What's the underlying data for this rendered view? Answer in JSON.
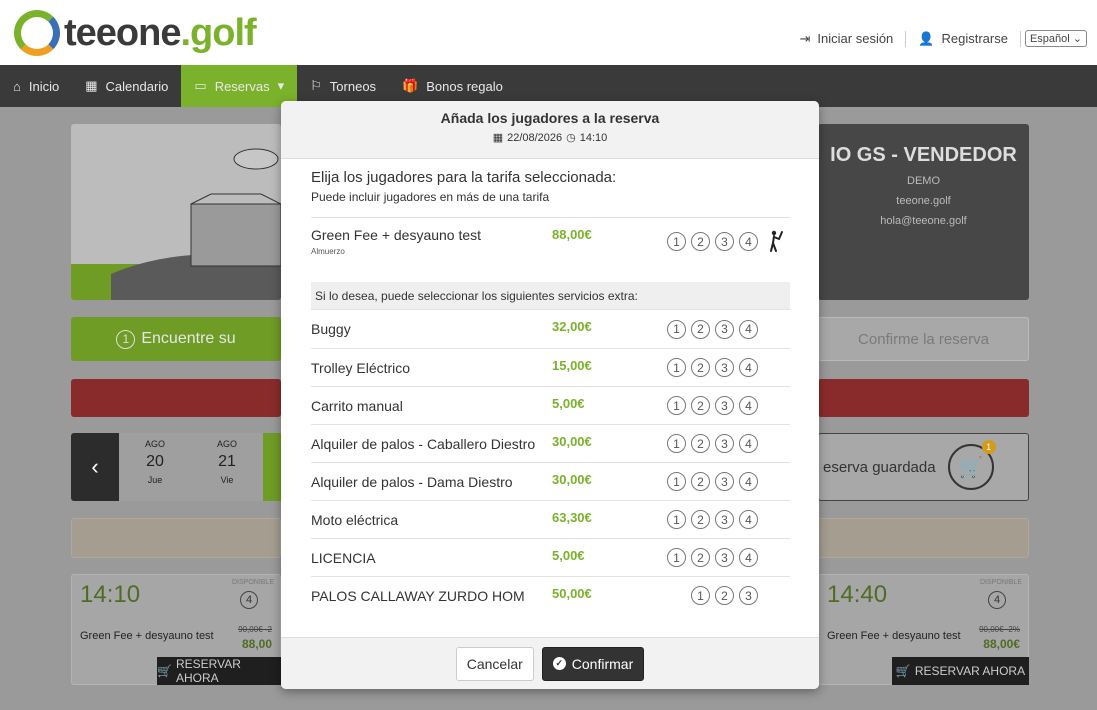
{
  "header": {
    "logo_text_dark": "teeone",
    "logo_text_green": ".golf",
    "login_label": "Iniciar sesión",
    "register_label": "Registrarse",
    "language": "Español"
  },
  "nav": {
    "items": [
      {
        "label": "Inicio",
        "icon": "home-icon"
      },
      {
        "label": "Calendario",
        "icon": "calendar-icon"
      },
      {
        "label": "Reservas",
        "icon": "card-icon",
        "caret": "▾"
      },
      {
        "label": "Torneos",
        "icon": "flag-icon"
      },
      {
        "label": "Bonos regalo",
        "icon": "gift-icon"
      }
    ]
  },
  "background": {
    "club_title": "IO GS - VENDEDOR",
    "club_line1": "DEMO",
    "club_line2": "teeone.golf",
    "club_email": "hola@teeone.golf",
    "step1_num": "1",
    "step1_label": "Encuentre su",
    "step3_label": "Confirme la reserva",
    "dates": [
      {
        "month": "AGO",
        "day": "20",
        "weekday": "Jue"
      },
      {
        "month": "AGO",
        "day": "21",
        "weekday": "Vie"
      }
    ],
    "cart_label": "eserva guardada",
    "cart_count": "1",
    "slot_left": {
      "time": "14:10",
      "available": "DISPONIBLE",
      "players": "4",
      "rate": "Green Fee + desyauno test",
      "old_price": "90,00€ -2",
      "price": "88,00",
      "button": "RESERVAR AHORA"
    },
    "slot_right": {
      "time": "14:40",
      "available": "DISPONIBLE",
      "players": "4",
      "rate": "Green Fee + desyauno test",
      "old_price": "90,00€ -2%",
      "price": "88,00€",
      "button": "RESERVAR AHORA"
    }
  },
  "modal": {
    "title": "Añada los jugadores a la reserva",
    "date": "22/08/2026",
    "time": "14:10",
    "intro_title": "Elija los jugadores para la tarifa seleccionada:",
    "intro_sub": "Puede incluir jugadores en más de una tarifa",
    "rate": {
      "name": "Green Fee + desyauno test",
      "sub": "Almuerzo",
      "price": "88,00€",
      "players": [
        "1",
        "2",
        "3",
        "4"
      ]
    },
    "extras_banner": "Si lo desea, puede seleccionar los siguientes servicios extra:",
    "extras": [
      {
        "name": "Buggy",
        "price": "32,00€",
        "players": [
          "1",
          "2",
          "3",
          "4"
        ]
      },
      {
        "name": "Trolley Eléctrico",
        "price": "15,00€",
        "players": [
          "1",
          "2",
          "3",
          "4"
        ]
      },
      {
        "name": "Carrito manual",
        "price": "5,00€",
        "players": [
          "1",
          "2",
          "3",
          "4"
        ]
      },
      {
        "name": "Alquiler de palos - Caballero Diestro",
        "price": "30,00€",
        "players": [
          "1",
          "2",
          "3",
          "4"
        ]
      },
      {
        "name": "Alquiler de palos - Dama Diestro",
        "price": "30,00€",
        "players": [
          "1",
          "2",
          "3",
          "4"
        ]
      },
      {
        "name": "Moto eléctrica",
        "price": "63,30€",
        "players": [
          "1",
          "2",
          "3",
          "4"
        ]
      },
      {
        "name": "LICENCIA",
        "price": "5,00€",
        "players": [
          "1",
          "2",
          "3",
          "4"
        ]
      },
      {
        "name": "PALOS CALLAWAY ZURDO HOM",
        "price": "50,00€",
        "players": [
          "1",
          "2",
          "3"
        ]
      }
    ],
    "cancel_label": "Cancelar",
    "confirm_label": "Confirmar"
  },
  "colors": {
    "brand_green": "#7ab22b",
    "nav_dark": "#3a3a3a",
    "confirm_dark": "#333333"
  }
}
